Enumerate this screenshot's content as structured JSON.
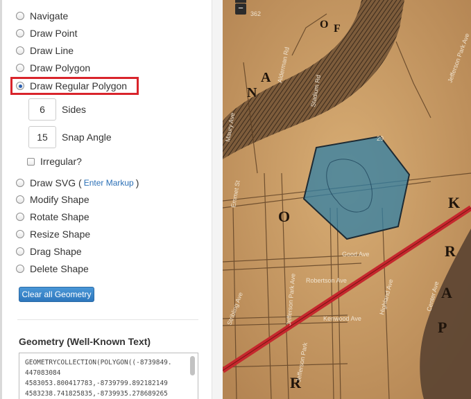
{
  "tools": [
    {
      "label": "Navigate",
      "selected": false
    },
    {
      "label": "Draw Point",
      "selected": false
    },
    {
      "label": "Draw Line",
      "selected": false
    },
    {
      "label": "Draw Polygon",
      "selected": false
    },
    {
      "label": "Draw Regular Polygon",
      "selected": true
    },
    {
      "label": "Draw SVG (",
      "selected": false
    },
    {
      "label": "Modify Shape",
      "selected": false
    },
    {
      "label": "Rotate Shape",
      "selected": false
    },
    {
      "label": "Resize Shape",
      "selected": false
    },
    {
      "label": "Drag Shape",
      "selected": false
    },
    {
      "label": "Delete Shape",
      "selected": false
    }
  ],
  "regular_polygon": {
    "sides_value": "6",
    "sides_label": "Sides",
    "snap_angle_value": "15",
    "snap_angle_label": "Snap Angle",
    "irregular_label": "Irregular?",
    "irregular_checked": false
  },
  "svg": {
    "link_label": "Enter Markup",
    "close_paren": ")"
  },
  "clear_button_label": "Clear all Geometry",
  "geometry": {
    "title": "Geometry (Well-Known Text)",
    "wkt_lines": [
      "GEOMETRYCOLLECTION(POLYGON((-8739849.",
      "447083084",
      "4583053.800417783,-8739799.892182149",
      "4583238.741825835,-8739935.278689265"
    ]
  },
  "map": {
    "zoom_out_label": "−",
    "labels": [
      "362",
      "Alderman Rd",
      "Stadium Rd",
      "29",
      "Good Ave",
      "Robertson Ave",
      "Highland Ave",
      "Center Ave",
      "Jefferson Park Ave",
      "Kenwood Ave",
      "Jefferson Park",
      "Stribling Ave",
      "Maury Ave",
      "Emmet St",
      "Jefferson Park Ave"
    ],
    "colors": {
      "parchment": "#c79a63",
      "polygon_fill": "#2f7fa6",
      "rail": "#c5282d"
    }
  }
}
